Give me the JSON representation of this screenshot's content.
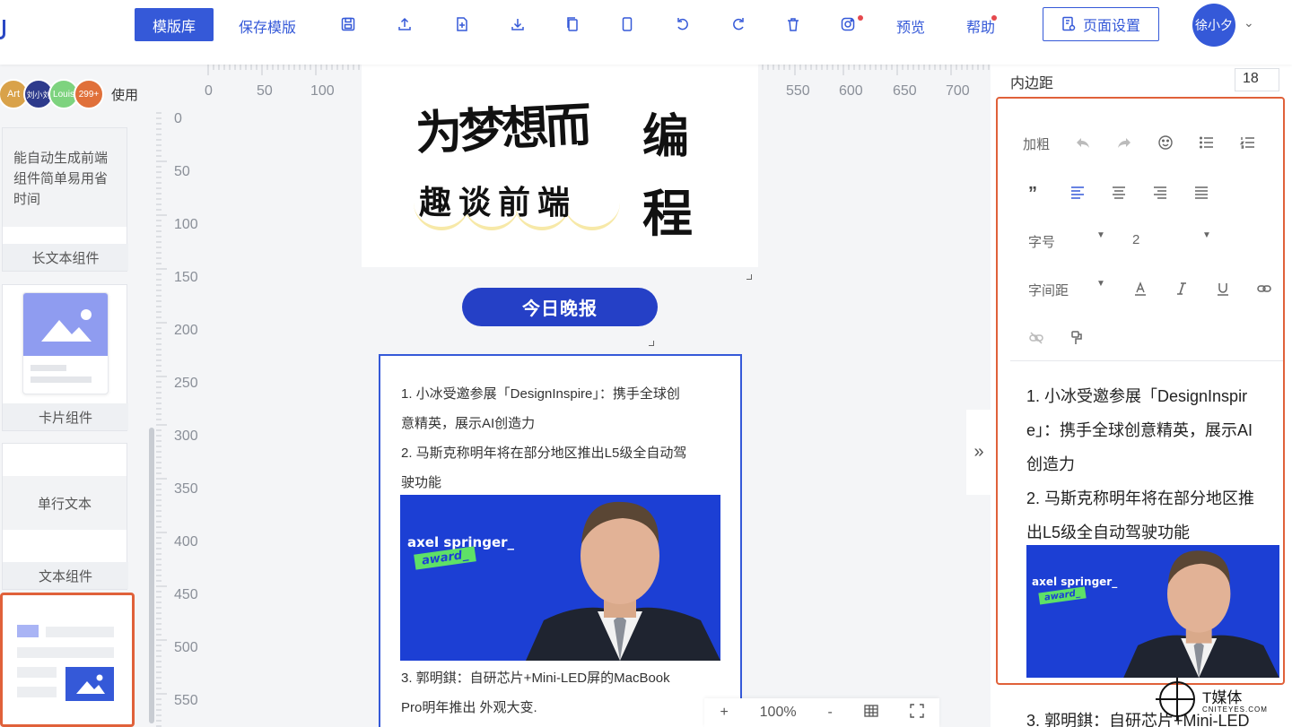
{
  "toolbar": {
    "template_library": "模版库",
    "save_template": "保存模版",
    "preview": "预览",
    "help": "帮助",
    "page_settings": "页面设置",
    "user_name": "徐小夕",
    "icons": [
      "save-icon",
      "upload-icon",
      "add-file-icon",
      "download-icon",
      "copy-icon",
      "mobile-icon",
      "undo-icon",
      "redo-icon",
      "delete-icon",
      "instagram-icon"
    ]
  },
  "sidebar": {
    "avatars": [
      "Art",
      "刘小刘",
      "Louis",
      "299+"
    ],
    "use_label": "使用",
    "long_text_preview": [
      "能自动生成前端",
      "组件简单易用省",
      "时间"
    ],
    "long_text_label": "长文本组件",
    "card_label": "卡片组件",
    "single_line_text": "单行文本",
    "text_label": "文本组件"
  },
  "rulers": {
    "top": [
      "0",
      "50",
      "100",
      "550",
      "600",
      "650",
      "700"
    ],
    "left": [
      "0",
      "50",
      "100",
      "150",
      "200",
      "250",
      "300",
      "350",
      "400",
      "450",
      "500",
      "550"
    ]
  },
  "page": {
    "banner_line1_a": "为梦想而",
    "banner_line1_b": "编",
    "banner_line2_a": "趣谈前端",
    "banner_line2_b": "程",
    "pill": "今日晚报",
    "news": [
      "1. 小冰受邀参展「DesignInspire」：携手全球创",
      "意精英，展示AI创造力",
      "2. 马斯克称明年将在部分地区推出L5级全自动驾",
      "驶功能",
      "3. 郭明錤：自研芯片+Mini-LED屏的MacBook",
      "Pro明年推出 外观大变."
    ],
    "photo_brand": "axel springer_",
    "photo_award": "award_"
  },
  "zoom": {
    "plus": "+",
    "level": "100%",
    "minus": "-"
  },
  "collapse": "»",
  "right_panel": {
    "padding_label": "内边距",
    "padding_value": "18",
    "bold": "加粗",
    "font_size_label": "字号",
    "font_size_value": "2",
    "letter_spacing_label": "字间距",
    "editor_lines": [
      "1. 小冰受邀参展「DesignInspir",
      "e」：携手全球创意精英，展示AI",
      "创造力",
      "2. 马斯克称明年将在部分地区推",
      "出L5级全自动驾驶功能",
      "3. 郭明錤：自研芯片+Mini-LED"
    ]
  },
  "watermark": {
    "title": "T媒体",
    "sub": "CNITEYES.COM"
  },
  "colors": {
    "accent": "#3559d8",
    "highlight": "#e0613a",
    "photo_bg": "#1c3fd4",
    "award_green": "#5ee067"
  }
}
